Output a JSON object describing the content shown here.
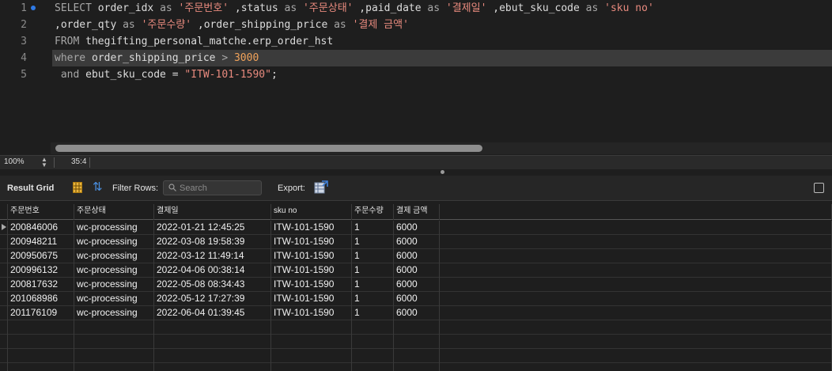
{
  "editor": {
    "line_numbers": [
      "1",
      "2",
      "3",
      "4",
      "5"
    ],
    "lines": [
      [
        {
          "t": "SELECT",
          "c": "kw"
        },
        {
          "t": " order_idx ",
          "c": ""
        },
        {
          "t": "as",
          "c": "kw"
        },
        {
          "t": " ",
          "c": ""
        },
        {
          "t": "'주문번호'",
          "c": "str"
        },
        {
          "t": " ,status ",
          "c": ""
        },
        {
          "t": "as",
          "c": "kw"
        },
        {
          "t": " ",
          "c": ""
        },
        {
          "t": "'주문상태'",
          "c": "str"
        },
        {
          "t": " ,paid_date ",
          "c": ""
        },
        {
          "t": "as",
          "c": "kw"
        },
        {
          "t": " ",
          "c": ""
        },
        {
          "t": "'결제일'",
          "c": "str"
        },
        {
          "t": " ,ebut_sku_code ",
          "c": ""
        },
        {
          "t": "as",
          "c": "kw"
        },
        {
          "t": " ",
          "c": ""
        },
        {
          "t": "'sku no'",
          "c": "str"
        }
      ],
      [
        {
          "t": ",order_qty ",
          "c": ""
        },
        {
          "t": "as",
          "c": "kw"
        },
        {
          "t": " ",
          "c": ""
        },
        {
          "t": "'주문수량'",
          "c": "str"
        },
        {
          "t": " ,order_shipping_price ",
          "c": ""
        },
        {
          "t": "as",
          "c": "kw"
        },
        {
          "t": " ",
          "c": ""
        },
        {
          "t": "'결제 금액'",
          "c": "str"
        }
      ],
      [
        {
          "t": "FROM",
          "c": "kw"
        },
        {
          "t": " thegifting_personal_matche.erp_order_hst",
          "c": ""
        }
      ],
      [
        {
          "t": "where",
          "c": "kw"
        },
        {
          "t": " order_shipping_price ",
          "c": ""
        },
        {
          "t": ">",
          "c": "kw"
        },
        {
          "t": " ",
          "c": ""
        },
        {
          "t": "3000",
          "c": "num"
        }
      ],
      [
        {
          "t": " and",
          "c": "kw"
        },
        {
          "t": " ebut_sku_code = ",
          "c": ""
        },
        {
          "t": "\"ITW-101-1590\"",
          "c": "str"
        },
        {
          "t": ";",
          "c": ""
        }
      ]
    ],
    "highlighted_line": 4
  },
  "status_bar": {
    "zoom": "100%",
    "cursor_position": "35:4"
  },
  "toolbar": {
    "result_grid_label": "Result Grid",
    "filter_rows_label": "Filter Rows:",
    "search_placeholder": "Search",
    "export_label": "Export:"
  },
  "grid": {
    "columns": [
      "주문번호",
      "주문상태",
      "결제일",
      "sku no",
      "주문수량",
      "결제 금액"
    ],
    "rows": [
      [
        "200846006",
        "wc-processing",
        "2022-01-21 12:45:25",
        "ITW-101-1590",
        "1",
        "6000"
      ],
      [
        "200948211",
        "wc-processing",
        "2022-03-08 19:58:39",
        "ITW-101-1590",
        "1",
        "6000"
      ],
      [
        "200950675",
        "wc-processing",
        "2022-03-12 11:49:14",
        "ITW-101-1590",
        "1",
        "6000"
      ],
      [
        "200996132",
        "wc-processing",
        "2022-04-06 00:38:14",
        "ITW-101-1590",
        "1",
        "6000"
      ],
      [
        "200817632",
        "wc-processing",
        "2022-05-08 08:34:43",
        "ITW-101-1590",
        "1",
        "6000"
      ],
      [
        "201068986",
        "wc-processing",
        "2022-05-12 17:27:39",
        "ITW-101-1590",
        "1",
        "6000"
      ],
      [
        "201176109",
        "wc-processing",
        "2022-06-04 01:39:45",
        "ITW-101-1590",
        "1",
        "6000"
      ]
    ],
    "empty_rows": 4
  }
}
